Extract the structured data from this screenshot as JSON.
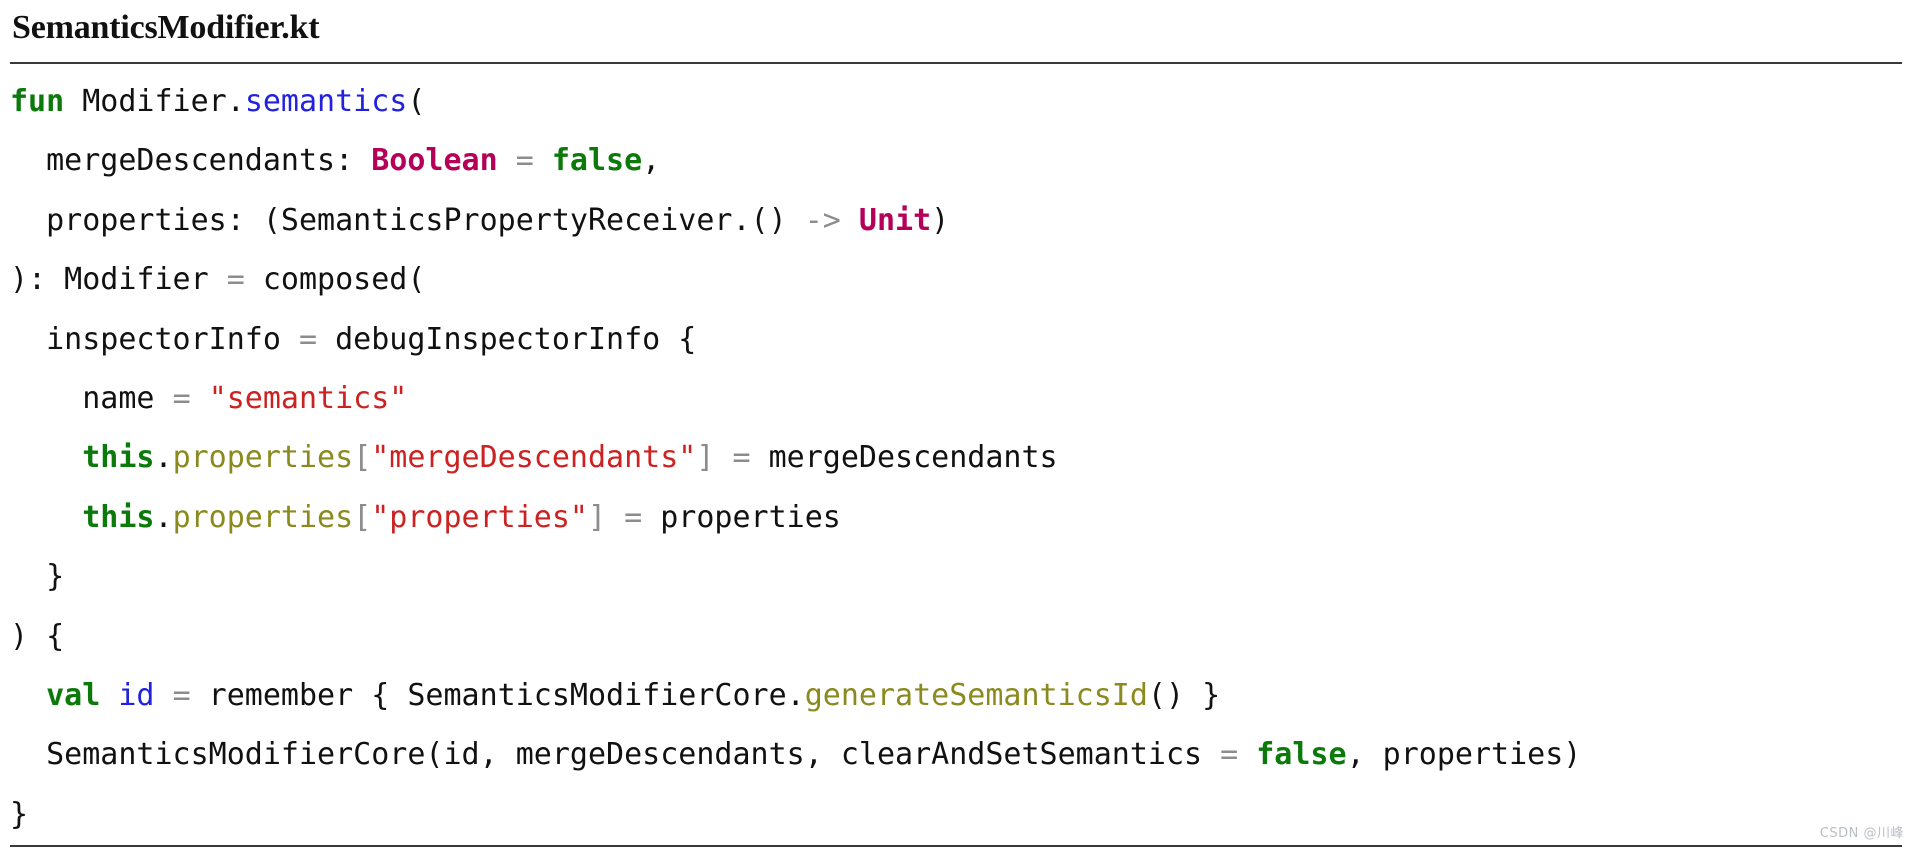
{
  "document": {
    "title": "SemanticsModifier.kt",
    "language": "kotlin",
    "watermark": "CSDN @川峰"
  },
  "colors": {
    "background": "#ffffff",
    "text": "#111111",
    "keyword": "#0b7a0b",
    "function_name": "#2222dd",
    "type": "#b5005a",
    "string": "#cc2222",
    "property": "#8a8a1f",
    "operator": "#8c8c8c",
    "rule": "#3a3a3a",
    "watermark": "#b9bec4"
  },
  "code": {
    "lines": [
      {
        "index": 1,
        "text": "fun Modifier.semantics(",
        "tokens": [
          {
            "t": "fun",
            "k": "kw"
          },
          {
            "t": " Modifier.",
            "k": "plain"
          },
          {
            "t": "semantics",
            "k": "fnname"
          },
          {
            "t": "(",
            "k": "plain"
          }
        ]
      },
      {
        "index": 2,
        "text": "  mergeDescendants: Boolean = false,",
        "tokens": [
          {
            "t": "  mergeDescendants: ",
            "k": "plain"
          },
          {
            "t": "Boolean",
            "k": "type"
          },
          {
            "t": " ",
            "k": "plain"
          },
          {
            "t": "=",
            "k": "op"
          },
          {
            "t": " ",
            "k": "plain"
          },
          {
            "t": "false",
            "k": "kw"
          },
          {
            "t": ",",
            "k": "plain"
          }
        ]
      },
      {
        "index": 3,
        "text": "  properties: (SemanticsPropertyReceiver.() -> Unit)",
        "tokens": [
          {
            "t": "  properties: (SemanticsPropertyReceiver.() ",
            "k": "plain"
          },
          {
            "t": "->",
            "k": "op"
          },
          {
            "t": " ",
            "k": "plain"
          },
          {
            "t": "Unit",
            "k": "type"
          },
          {
            "t": ")",
            "k": "plain"
          }
        ]
      },
      {
        "index": 4,
        "text": "): Modifier = composed(",
        "tokens": [
          {
            "t": "): Modifier ",
            "k": "plain"
          },
          {
            "t": "=",
            "k": "op"
          },
          {
            "t": " composed(",
            "k": "plain"
          }
        ]
      },
      {
        "index": 5,
        "text": "  inspectorInfo = debugInspectorInfo {",
        "tokens": [
          {
            "t": "  inspectorInfo ",
            "k": "plain"
          },
          {
            "t": "=",
            "k": "op"
          },
          {
            "t": " debugInspectorInfo {",
            "k": "plain"
          }
        ]
      },
      {
        "index": 6,
        "text": "    name = \"semantics\"",
        "tokens": [
          {
            "t": "    name ",
            "k": "plain"
          },
          {
            "t": "=",
            "k": "op"
          },
          {
            "t": " ",
            "k": "plain"
          },
          {
            "t": "\"semantics\"",
            "k": "str"
          }
        ]
      },
      {
        "index": 7,
        "text": "    this.properties[\"mergeDescendants\"] = mergeDescendants",
        "tokens": [
          {
            "t": "    ",
            "k": "plain"
          },
          {
            "t": "this",
            "k": "kw"
          },
          {
            "t": ".",
            "k": "plain"
          },
          {
            "t": "properties",
            "k": "prop"
          },
          {
            "t": "[",
            "k": "op"
          },
          {
            "t": "\"mergeDescendants\"",
            "k": "str"
          },
          {
            "t": "]",
            "k": "op"
          },
          {
            "t": " ",
            "k": "plain"
          },
          {
            "t": "=",
            "k": "op"
          },
          {
            "t": " mergeDescendants",
            "k": "plain"
          }
        ]
      },
      {
        "index": 8,
        "text": "    this.properties[\"properties\"] = properties",
        "tokens": [
          {
            "t": "    ",
            "k": "plain"
          },
          {
            "t": "this",
            "k": "kw"
          },
          {
            "t": ".",
            "k": "plain"
          },
          {
            "t": "properties",
            "k": "prop"
          },
          {
            "t": "[",
            "k": "op"
          },
          {
            "t": "\"properties\"",
            "k": "str"
          },
          {
            "t": "]",
            "k": "op"
          },
          {
            "t": " ",
            "k": "plain"
          },
          {
            "t": "=",
            "k": "op"
          },
          {
            "t": " properties",
            "k": "plain"
          }
        ]
      },
      {
        "index": 9,
        "text": "  }",
        "tokens": [
          {
            "t": "  }",
            "k": "plain"
          }
        ]
      },
      {
        "index": 10,
        "text": ") {",
        "tokens": [
          {
            "t": ") {",
            "k": "plain"
          }
        ]
      },
      {
        "index": 11,
        "text": "  val id = remember { SemanticsModifierCore.generateSemanticsId() }",
        "tokens": [
          {
            "t": "  ",
            "k": "plain"
          },
          {
            "t": "val",
            "k": "kw"
          },
          {
            "t": " ",
            "k": "plain"
          },
          {
            "t": "id",
            "k": "fnname"
          },
          {
            "t": " ",
            "k": "plain"
          },
          {
            "t": "=",
            "k": "op"
          },
          {
            "t": " remember { SemanticsModifierCore.",
            "k": "plain"
          },
          {
            "t": "generateSemanticsId",
            "k": "prop"
          },
          {
            "t": "() }",
            "k": "plain"
          }
        ]
      },
      {
        "index": 12,
        "text": "  SemanticsModifierCore(id, mergeDescendants, clearAndSetSemantics = false, properties)",
        "tokens": [
          {
            "t": "  SemanticsModifierCore(id, mergeDescendants, clearAndSetSemantics ",
            "k": "plain"
          },
          {
            "t": "=",
            "k": "op"
          },
          {
            "t": " ",
            "k": "plain"
          },
          {
            "t": "false",
            "k": "kw"
          },
          {
            "t": ", properties)",
            "k": "plain"
          }
        ]
      },
      {
        "index": 13,
        "text": "}",
        "tokens": [
          {
            "t": "}",
            "k": "plain"
          }
        ]
      }
    ]
  }
}
